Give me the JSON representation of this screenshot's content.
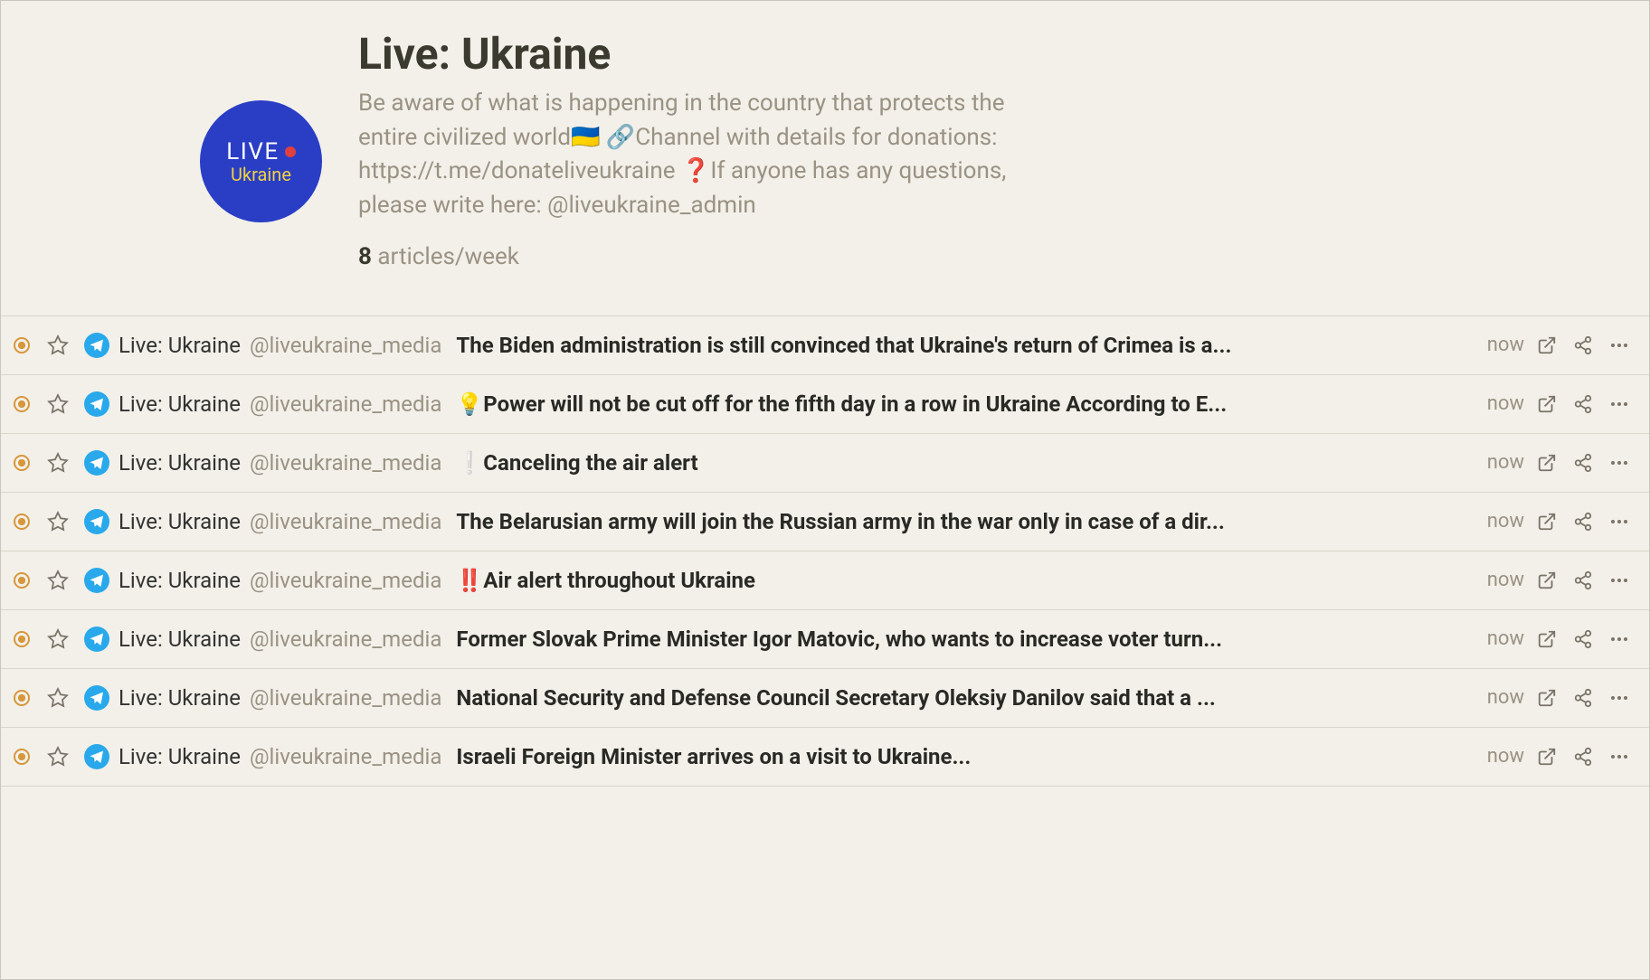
{
  "header": {
    "avatar": {
      "line1": "LIVE",
      "line2": "Ukraine"
    },
    "title": "Live: Ukraine",
    "description": "Be aware of what is happening in the country that protects the entire civilized world🇺🇦 🔗Channel with details for donations: https://t.me/donateliveukraine ❓If anyone has any questions, please write here: @liveukraine_admin",
    "stat_count": "8",
    "stat_label": "articles/week"
  },
  "source_name": "Live: Ukraine",
  "source_handle": "@liveukraine_media",
  "articles": [
    {
      "headline": "The Biden administration is still convinced that Ukraine's return of Crimea is a...",
      "time": "now"
    },
    {
      "headline": "💡Power will not be cut off for the fifth day in a row in Ukraine According to E...",
      "time": "now"
    },
    {
      "headline": "❕Canceling the air alert",
      "time": "now"
    },
    {
      "headline": "The Belarusian army will join the Russian army in the war only in case of a dir...",
      "time": "now"
    },
    {
      "headline": "‼️Air alert throughout Ukraine",
      "time": "now"
    },
    {
      "headline": "Former Slovak Prime Minister Igor Matovic, who wants to increase voter turn...",
      "time": "now"
    },
    {
      "headline": "National Security and Defense Council Secretary Oleksiy Danilov said that a ...",
      "time": "now"
    },
    {
      "headline": "Israeli Foreign Minister arrives on a visit to Ukraine...",
      "time": "now"
    }
  ]
}
